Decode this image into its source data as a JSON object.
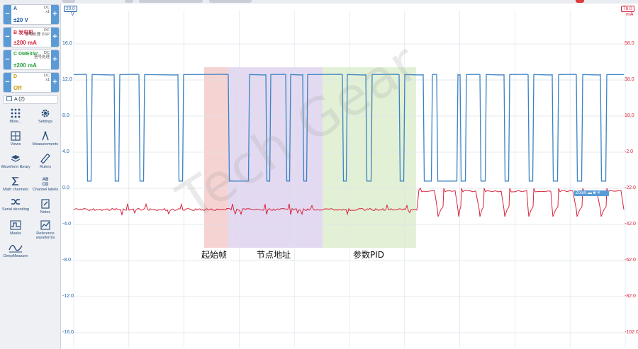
{
  "channels": [
    {
      "id": "A",
      "name": "A",
      "coupling": "DC",
      "info": "x1",
      "range": "±20 V",
      "color": "#1f5ea8"
    },
    {
      "id": "B",
      "name": "B 发电机",
      "coupling": "DC",
      "info": "信号处理 DSP",
      "range": "±200 mA",
      "color": "#d6243c"
    },
    {
      "id": "C",
      "name": "C DME35#",
      "coupling": "DC",
      "info": "信号处理",
      "range": "±200 mA",
      "color": "#2a9f3e"
    },
    {
      "id": "D",
      "name": "D",
      "coupling": "DC",
      "info": "x1",
      "range": "Off",
      "color": "#c8a000"
    }
  ],
  "math_channel": {
    "label": "A (2)"
  },
  "tools": [
    {
      "label": "More...",
      "icon": "grid-dots-icon"
    },
    {
      "label": "Settings",
      "icon": "gear-icon"
    },
    {
      "label": "Views",
      "icon": "views-grid-icon"
    },
    {
      "label": "Measurements",
      "icon": "compass-icon"
    },
    {
      "label": "Waveform library",
      "icon": "library-icon"
    },
    {
      "label": "Rulers",
      "icon": "ruler-icon"
    },
    {
      "label": "Math channels",
      "icon": "sigma-icon"
    },
    {
      "label": "Channel labels",
      "icon": "abcd-icon"
    },
    {
      "label": "Serial decoding",
      "icon": "serial-icon"
    },
    {
      "label": "Notes",
      "icon": "note-icon"
    },
    {
      "label": "Masks",
      "icon": "mask-icon"
    },
    {
      "label": "Reference waveforms",
      "icon": "reference-icon"
    },
    {
      "label": "DeepMeasure",
      "icon": "deepmeasure-icon"
    }
  ],
  "axes": {
    "left": {
      "tag": "20.0",
      "unit": "V",
      "ticks": [
        "16.0",
        "12.0",
        "8.0",
        "4.0",
        "0.0",
        "-4.0",
        "-8.0",
        "-12.0",
        "-16.0"
      ]
    },
    "right": {
      "tag": "78.0",
      "unit": "mA",
      "ticks": [
        "58.0",
        "38.0",
        "18.0",
        "-2.0",
        "-22.0",
        "-42.0",
        "-62.0",
        "-82.0",
        "-102.0"
      ]
    }
  },
  "annotations": {
    "start_frame": "起始帧",
    "node_address": "节点地址",
    "params_pid": "参数PID"
  },
  "zoom_box": {
    "label": "Zoom"
  },
  "watermark": "Tech Gear",
  "colors": {
    "channel_a": "#3b83c4",
    "channel_b": "#d6243c",
    "region_start": "#f3c4c4",
    "region_node": "#d9cdec",
    "region_pid": "#d8ecc8"
  }
}
